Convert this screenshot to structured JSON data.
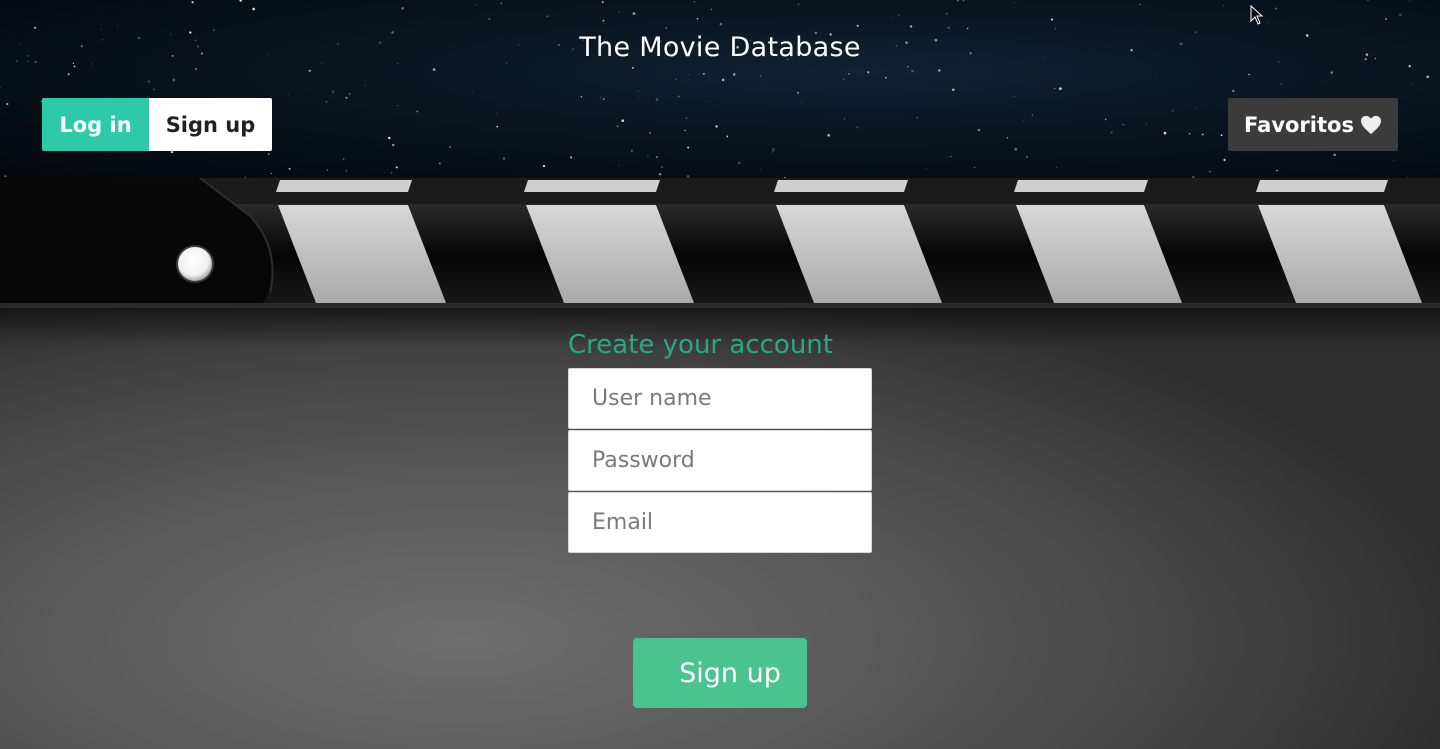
{
  "header": {
    "site_title": "The Movie Database",
    "login_label": "Log in",
    "signup_label": "Sign up",
    "favorites_label": "Favoritos",
    "favorites_icon": "heart-icon"
  },
  "form": {
    "title": "Create your account",
    "username_placeholder": "User name",
    "password_placeholder": "Password",
    "email_placeholder": "Email",
    "submit_label": "Sign up"
  },
  "colors": {
    "accent_teal": "#2ec9a8",
    "form_title": "#2aa884",
    "submit_green": "#4ac38e",
    "favorites_bg": "#3b3b3b"
  }
}
